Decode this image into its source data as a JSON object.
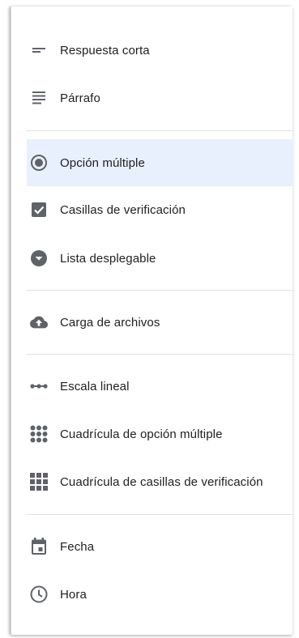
{
  "menu": {
    "items": [
      {
        "label": "Respuesta corta",
        "icon": "short-answer-icon"
      },
      {
        "label": "Párrafo",
        "icon": "paragraph-icon"
      },
      {
        "label": "Opción múltiple",
        "icon": "radio-button-icon",
        "selected": true
      },
      {
        "label": "Casillas de verificación",
        "icon": "checkbox-icon"
      },
      {
        "label": "Lista desplegable",
        "icon": "dropdown-icon"
      },
      {
        "label": "Carga de archivos",
        "icon": "cloud-upload-icon"
      },
      {
        "label": "Escala lineal",
        "icon": "linear-scale-icon"
      },
      {
        "label": "Cuadrícula de opción múltiple",
        "icon": "dots-grid-icon"
      },
      {
        "label": "Cuadrícula de casillas de verificación",
        "icon": "squares-grid-icon"
      },
      {
        "label": "Fecha",
        "icon": "calendar-icon"
      },
      {
        "label": "Hora",
        "icon": "clock-icon"
      }
    ]
  },
  "colors": {
    "icon": "#5f6368",
    "text": "#202124",
    "selected_background": "#e8f0fe",
    "divider": "#e0e0e0"
  }
}
